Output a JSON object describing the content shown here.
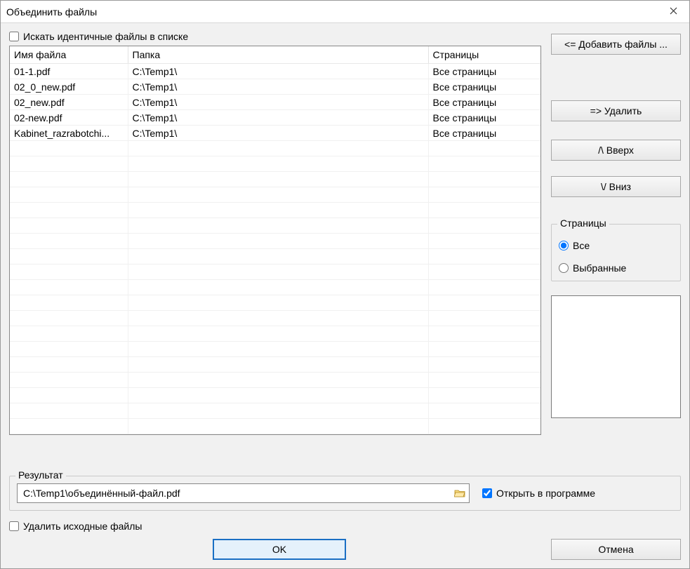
{
  "window": {
    "title": "Объединить файлы"
  },
  "checks": {
    "search_identical_label": "Искать идентичные файлы в списке",
    "delete_source_label": "Удалить исходные файлы",
    "open_in_program_label": "Открыть в программе",
    "open_in_program_checked": true
  },
  "table": {
    "headers": {
      "name": "Имя файла",
      "folder": "Папка",
      "pages": "Страницы"
    },
    "rows": [
      {
        "name": "01-1.pdf",
        "folder": "C:\\Temp1\\",
        "pages": "Все страницы"
      },
      {
        "name": "02_0_new.pdf",
        "folder": "C:\\Temp1\\",
        "pages": "Все страницы"
      },
      {
        "name": "02_new.pdf",
        "folder": "C:\\Temp1\\",
        "pages": "Все страницы"
      },
      {
        "name": "02-new.pdf",
        "folder": "C:\\Temp1\\",
        "pages": "Все страницы"
      },
      {
        "name": "Kabinet_razrabotchi...",
        "folder": "C:\\Temp1\\",
        "pages": "Все страницы"
      }
    ]
  },
  "buttons": {
    "add_files": "<= Добавить файлы ...",
    "remove": "=>  Удалить",
    "up": "/\\   Вверх",
    "down": "\\/   Вниз",
    "ok": "OK",
    "cancel": "Отмена"
  },
  "pages_group": {
    "title": "Страницы",
    "all": "Все",
    "selected": "Выбранные"
  },
  "result": {
    "title": "Результат",
    "path": "C:\\Temp1\\объединённый-файл.pdf"
  }
}
